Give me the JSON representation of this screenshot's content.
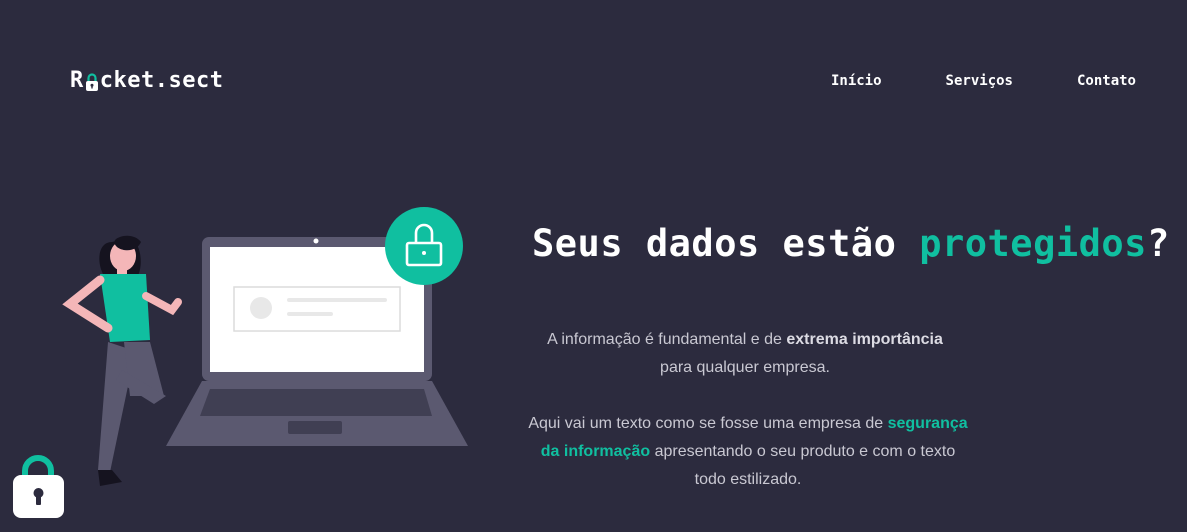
{
  "brand": {
    "prefix": "R",
    "suffix": "cket.sect"
  },
  "nav": {
    "items": [
      {
        "label": "Início"
      },
      {
        "label": "Serviços"
      },
      {
        "label": "Contato"
      }
    ]
  },
  "hero": {
    "headline_main": "Seus dados estão ",
    "headline_accent": "protegidos",
    "headline_end": "?",
    "p1_before": "A informação é fundamental e de ",
    "p1_bold": "extrema importância",
    "p1_after": " para qualquer empresa.",
    "p2_before": "Aqui vai um texto como se fosse uma empresa de ",
    "p2_accent": "segurança da informação",
    "p2_after": " apresentando o seu produto e com o texto todo estilizado."
  },
  "colors": {
    "background": "#2c2b3e",
    "accent": "#10bfa0",
    "text": "#ffffff"
  },
  "icons": [
    "padlock-icon",
    "padlock-badge-icon",
    "floating-lock-icon"
  ]
}
